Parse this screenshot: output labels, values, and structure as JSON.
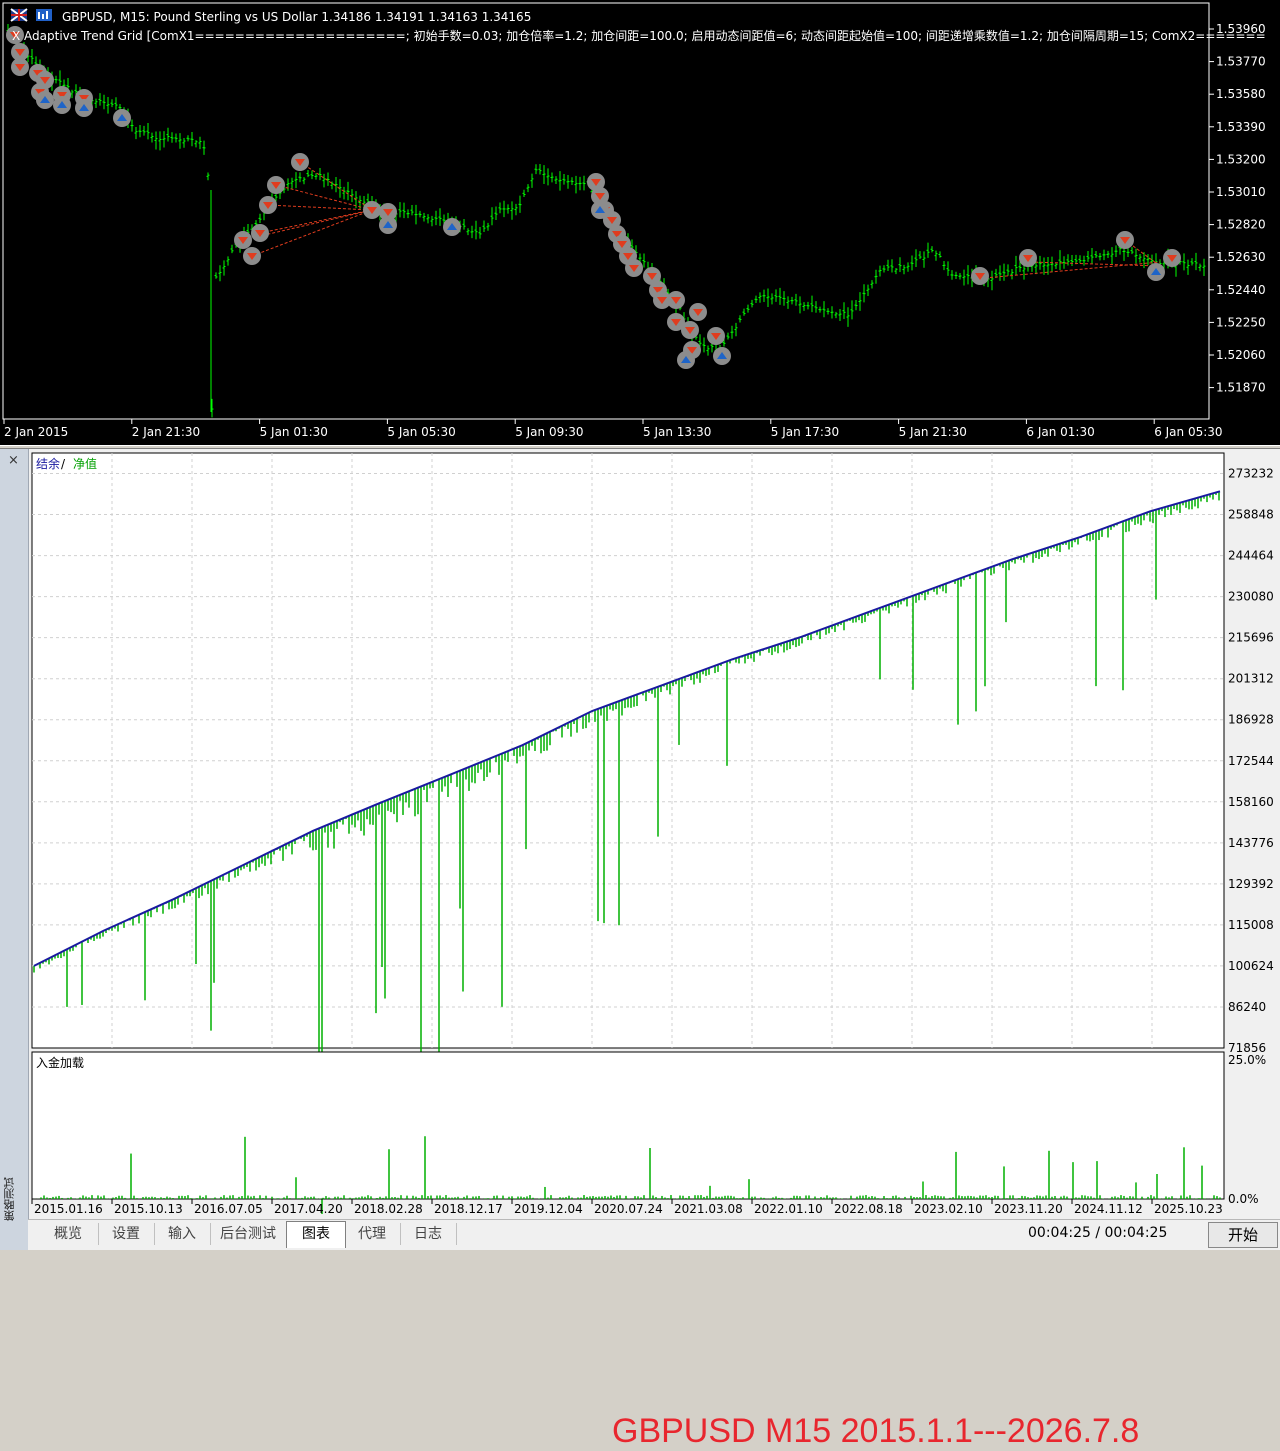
{
  "colors": {
    "bull": "#00ff00",
    "bear": "#00ff00",
    "balance": "#1a1aa0",
    "equity": "#00b000",
    "chart_bg": "#000000",
    "axis_text": "#ffffff",
    "sell_marker": "#e03c1e",
    "buy_marker": "#1e64c8",
    "marker_ring": "#909090",
    "title_red": "#e8262e"
  },
  "price_chart": {
    "header_icons": [
      "flag-uk-icon",
      "indicator-icon"
    ],
    "title": "GBPUSD, M15:  Pound Sterling vs US Dollar  1.34186 1.34191 1.34163 1.34165",
    "ea_line": "X Adaptive Trend Grid [ComX1=====================; 初始手数=0.03; 加仓倍率=1.2; 加仓间距=100.0; 启用动态间距值=6; 动态间距起始值=100; 间距递增乘数值=1.2; 加仓间隔周期=15; ComX2=======",
    "y_ticks": [
      "1.53960",
      "1.53770",
      "1.53580",
      "1.53390",
      "1.53200",
      "1.53010",
      "1.52820",
      "1.52630",
      "1.52440",
      "1.52250",
      "1.52060",
      "1.51870"
    ],
    "x_ticks": [
      "2 Jan 2015",
      "2 Jan 21:30",
      "5 Jan 01:30",
      "5 Jan 05:30",
      "5 Jan 09:30",
      "5 Jan 13:30",
      "5 Jan 17:30",
      "5 Jan 21:30",
      "6 Jan 01:30",
      "6 Jan 05:30"
    ]
  },
  "tester": {
    "close_icon": "×",
    "vertical_label": "策略测试",
    "legend": {
      "balance": "结余",
      "slash": " / ",
      "equity": "净值"
    },
    "y_ticks": [
      "273232",
      "258848",
      "244464",
      "230080",
      "215696",
      "201312",
      "186928",
      "172544",
      "158160",
      "143776",
      "129392",
      "115008",
      "100624",
      "86240",
      "71856"
    ],
    "x_ticks": [
      "2015.01.16",
      "2015.10.13",
      "2016.07.05",
      "2017.04.20",
      "2018.02.28",
      "2018.12.17",
      "2019.12.04",
      "2020.07.24",
      "2021.03.08",
      "2022.01.10",
      "2022.08.18",
      "2023.02.10",
      "2023.11.20",
      "2024.11.12",
      "2025.10.23"
    ],
    "overlay_text": "GBPUSD M15 2015.1.1---2026.7.8",
    "load_panel": {
      "title": "入金加载",
      "top_tick": "25.0%",
      "bottom_tick": "0.0%"
    },
    "tabs": [
      "概览",
      "设置",
      "输入",
      "后台测试",
      "图表",
      "代理",
      "日志"
    ],
    "active_tab": "图表",
    "timer": "00:04:25 / 00:04:25",
    "start_label": "开始"
  },
  "chart_data": [
    {
      "type": "line",
      "title": "",
      "series": [
        {
          "name": "结余",
          "values": [
            100624,
            113000,
            124000,
            136000,
            148000,
            158160,
            168000,
            178000,
            190000,
            199000,
            208000,
            216000,
            225000,
            234000,
            243000,
            251000,
            260000,
            267000
          ]
        },
        {
          "name": "净值",
          "values": [
            98500,
            111000,
            120000,
            133000,
            140000,
            150000,
            160000,
            172000,
            185000,
            195000,
            205000,
            213000,
            222000,
            231000,
            240000,
            248000,
            256000,
            264000
          ]
        }
      ],
      "x": [
        "2015.01",
        "2015.08",
        "2016.03",
        "2016.10",
        "2017.04",
        "2017.11",
        "2018.06",
        "2019.01",
        "2019.08",
        "2020.03",
        "2020.10",
        "2021.05",
        "2021.12",
        "2022.07",
        "2023.02",
        "2023.09",
        "2024.11",
        "2026.01"
      ],
      "ylim": [
        71856,
        280424
      ],
      "grid": true,
      "legend": "top-left"
    }
  ]
}
